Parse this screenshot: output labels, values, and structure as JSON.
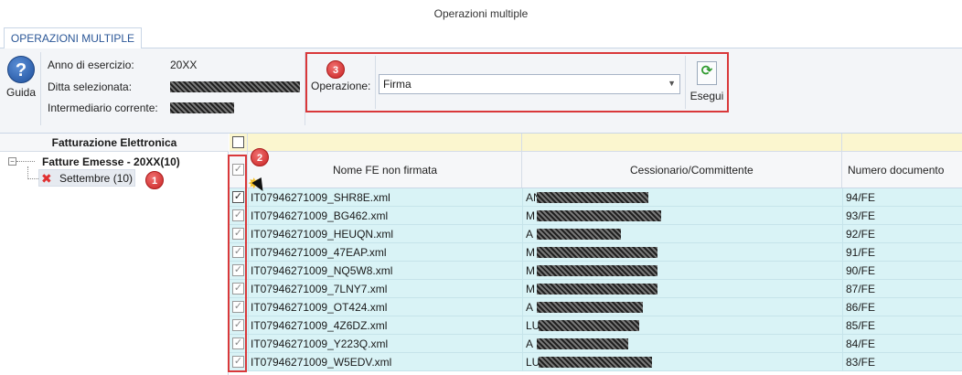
{
  "window": {
    "title": "Operazioni multiple"
  },
  "tabs": [
    {
      "label": "OPERAZIONI MULTIPLE"
    }
  ],
  "ribbon": {
    "guida_label": "Guida",
    "anno_label": "Anno di esercizio:",
    "anno_value": "20XX",
    "ditta_label": "Ditta selezionata:",
    "intermediario_label": "Intermediario corrente:",
    "operazione_label": "Operazione:",
    "operazione_value": "Firma",
    "esegui_label": "Esegui"
  },
  "badges": {
    "b1": "1",
    "b2": "2",
    "b3": "3"
  },
  "tree": {
    "header": "Fatturazione Elettronica",
    "root": "Fatture Emesse - 20XX(10)",
    "child": "Settembre (10)"
  },
  "grid": {
    "columns": [
      "Nome FE non firmata",
      "Cessionario/Committente",
      "Numero documento"
    ],
    "rows": [
      {
        "file": "IT07946271009_SHR8E.xml",
        "cliente_prefix": "AN",
        "numero": "94/FE"
      },
      {
        "file": "IT07946271009_BG462.xml",
        "cliente_prefix": "M",
        "numero": "93/FE"
      },
      {
        "file": "IT07946271009_HEUQN.xml",
        "cliente_prefix": "A",
        "numero": "92/FE"
      },
      {
        "file": "IT07946271009_47EAP.xml",
        "cliente_prefix": "M",
        "numero": "91/FE"
      },
      {
        "file": "IT07946271009_NQ5W8.xml",
        "cliente_prefix": "M",
        "numero": "90/FE"
      },
      {
        "file": "IT07946271009_7LNY7.xml",
        "cliente_prefix": "M",
        "numero": "87/FE"
      },
      {
        "file": "IT07946271009_OT424.xml",
        "cliente_prefix": "A",
        "numero": "86/FE"
      },
      {
        "file": "IT07946271009_4Z6DZ.xml",
        "cliente_prefix": "LU",
        "numero": "85/FE"
      },
      {
        "file": "IT07946271009_Y223Q.xml",
        "cliente_prefix": "A",
        "numero": "84/FE"
      },
      {
        "file": "IT07946271009_W5EDV.xml",
        "cliente_prefix": "LU",
        "numero": "83/FE"
      }
    ]
  },
  "colors": {
    "accent_red": "#d9383a",
    "row_bg": "#d9f3f6",
    "filter_bg": "#fbf6cf",
    "tab_text": "#2b5797"
  }
}
